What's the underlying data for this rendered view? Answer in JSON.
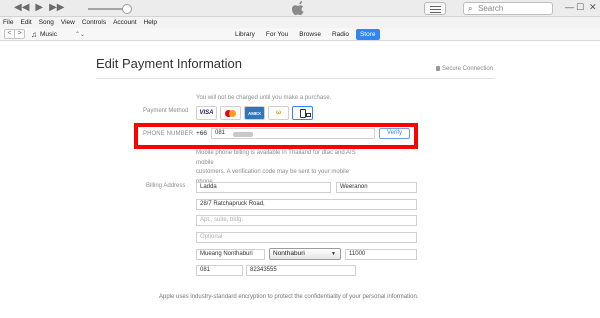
{
  "topbar": {
    "search_placeholder": "Search",
    "transport_icons": [
      "rewind-icon",
      "play-icon",
      "fast-forward-icon"
    ],
    "window_controls": [
      "minimize",
      "maximize",
      "close"
    ]
  },
  "menu": {
    "items": [
      "File",
      "Edit",
      "Song",
      "View",
      "Controls",
      "Account",
      "Help"
    ]
  },
  "nav": {
    "back": "<",
    "forward": ">",
    "media_label": "Music",
    "tabs": [
      {
        "label": "Library"
      },
      {
        "label": "For You"
      },
      {
        "label": "Browse"
      },
      {
        "label": "Radio"
      },
      {
        "label": "Store"
      }
    ],
    "active_tab": "Store",
    "accent": "#2f86f6"
  },
  "page": {
    "title": "Edit Payment Information",
    "secure_text": "Secure Connection",
    "charge_note": "You will not be charged until you make a purchase.",
    "payment_method_label": "Payment Method",
    "cards": [
      "VISA",
      "MasterCard",
      "AMEX",
      "Wallet",
      "Mobile Phone"
    ],
    "phone_label": "PHONE NUMBER",
    "country_code": "+66",
    "phone_value": "081",
    "verify_label": "Verify",
    "mobile_note_1": "Mobile phone billing is available in Thailand for dtac and AIS mobile",
    "mobile_note_2": "customers. A verification code may be sent to your mobile phone.",
    "billing_label": "Billing Address",
    "first_name": "Ladda",
    "last_name": "Weeranon",
    "street": "28/7 Ratchapruck Road,",
    "apt_placeholder": "Apt., suite, bldg.",
    "optional_placeholder": "Optional",
    "city": "Mueang Nonthaburi",
    "state": "Nonthaburi",
    "postcode": "11000",
    "area_code": "081",
    "phone2": "82343555",
    "footer": "Apple uses industry-standard encryption to protect the confidentiality of your personal information.",
    "highlight_color": "#ff0000"
  }
}
